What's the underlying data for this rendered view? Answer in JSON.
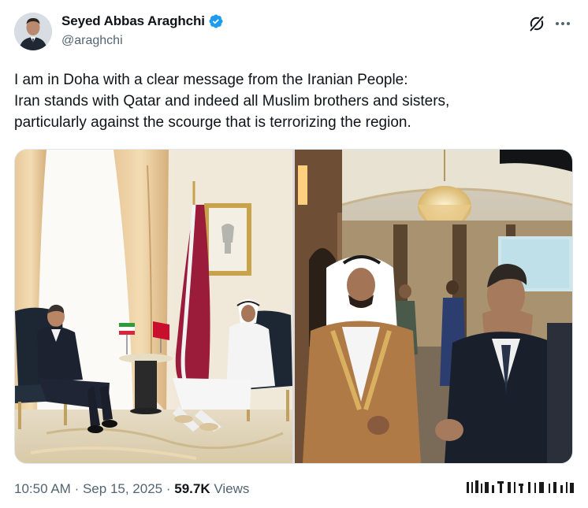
{
  "author": {
    "display_name": "Seyed Abbas Araghchi",
    "handle": "@araghchi",
    "verified": true,
    "verified_color": "#1d9bf0"
  },
  "actions": {
    "grok_icon": "grok-icon",
    "more_icon": "more-horizontal-icon"
  },
  "tweet": {
    "lines": [
      "I am in Doha with a clear message from the Iranian People:",
      "Iran stands with Qatar and indeed all Muslim brothers and sisters,",
      "particularly against the scourge that is terrorizing the region."
    ]
  },
  "media": {
    "count": 2
  },
  "footer": {
    "time": "10:50 AM",
    "separator": "·",
    "date": "Sep 15, 2025",
    "views_count": "59.7K",
    "views_label": "Views"
  },
  "colors": {
    "text_primary": "#0f1419",
    "text_secondary": "#536471",
    "accent": "#1d9bf0"
  }
}
